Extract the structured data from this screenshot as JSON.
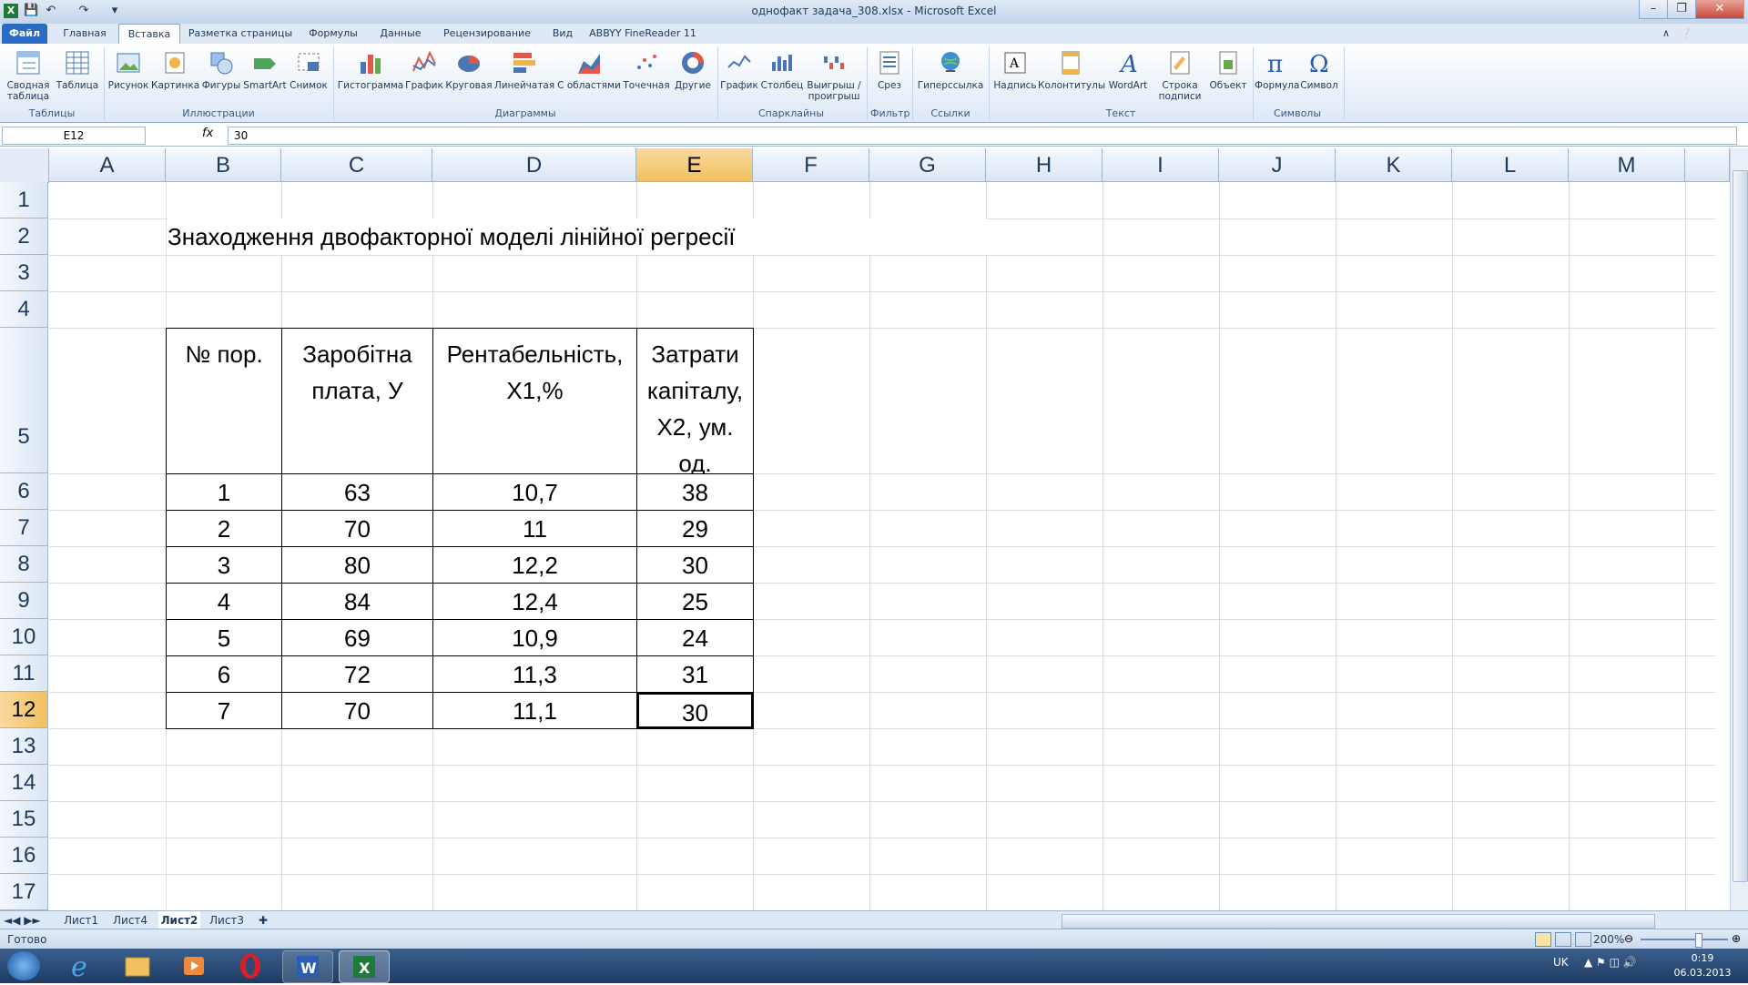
{
  "window": {
    "title": "однофакт задача_308.xlsx - Microsoft Excel"
  },
  "ribbon_tabs": [
    "Файл",
    "Главная",
    "Вставка",
    "Разметка страницы",
    "Формулы",
    "Данные",
    "Рецензирование",
    "Вид",
    "ABBYY FineReader 11"
  ],
  "ribbon": {
    "tables": {
      "label": "Таблицы",
      "buttons": [
        "Сводная таблица",
        "Таблица"
      ]
    },
    "illustrations": {
      "label": "Иллюстрации",
      "buttons": [
        "Рисунок",
        "Картинка",
        "Фигуры",
        "SmartArt",
        "Снимок"
      ]
    },
    "charts": {
      "label": "Диаграммы",
      "buttons": [
        "Гистограмма",
        "График",
        "Круговая",
        "Линейчатая",
        "С областями",
        "Точечная",
        "Другие"
      ]
    },
    "sparklines": {
      "label": "Спарклайны",
      "buttons": [
        "График",
        "Столбец",
        "Выигрыш / проигрыш"
      ]
    },
    "filter": {
      "label": "Фильтр",
      "buttons": [
        "Срез"
      ]
    },
    "links": {
      "label": "Ссылки",
      "buttons": [
        "Гиперссылка"
      ]
    },
    "text": {
      "label": "Текст",
      "buttons": [
        "Надпись",
        "Колонтитулы",
        "WordArt",
        "Строка подписи",
        "Объект"
      ]
    },
    "symbols": {
      "label": "Символы",
      "buttons": [
        "Формула",
        "Символ"
      ]
    }
  },
  "formula_bar": {
    "name_box": "E12",
    "fx": "fx",
    "value": "30"
  },
  "columns": [
    "A",
    "B",
    "C",
    "D",
    "E",
    "F",
    "G",
    "H",
    "I",
    "J",
    "K",
    "L",
    "M"
  ],
  "rows": [
    "1",
    "2",
    "3",
    "4",
    "5",
    "6",
    "7",
    "8",
    "9",
    "10",
    "11",
    "12",
    "13",
    "14",
    "15",
    "16",
    "17"
  ],
  "sheet": {
    "title": "Знаходження двофакторної моделі лінійної регресії",
    "headers": [
      "№ пор.",
      "Заробітна плата, У",
      "Рентабельність, Х1,%",
      "Затрати капіталу, Х2, ум. од."
    ],
    "data": [
      [
        "1",
        "63",
        "10,7",
        "38"
      ],
      [
        "2",
        "70",
        "11",
        "29"
      ],
      [
        "3",
        "80",
        "12,2",
        "30"
      ],
      [
        "4",
        "84",
        "12,4",
        "25"
      ],
      [
        "5",
        "69",
        "10,9",
        "24"
      ],
      [
        "6",
        "72",
        "11,3",
        "31"
      ],
      [
        "7",
        "70",
        "11,1",
        "30"
      ]
    ]
  },
  "sheet_tabs": [
    "Лист1",
    "Лист4",
    "Лист2",
    "Лист3"
  ],
  "active_sheet": "Лист2",
  "status": {
    "ready": "Готово",
    "zoom": "200%"
  },
  "taskbar": {
    "lang": "UK",
    "time": "0:19",
    "date": "06.03.2013"
  }
}
